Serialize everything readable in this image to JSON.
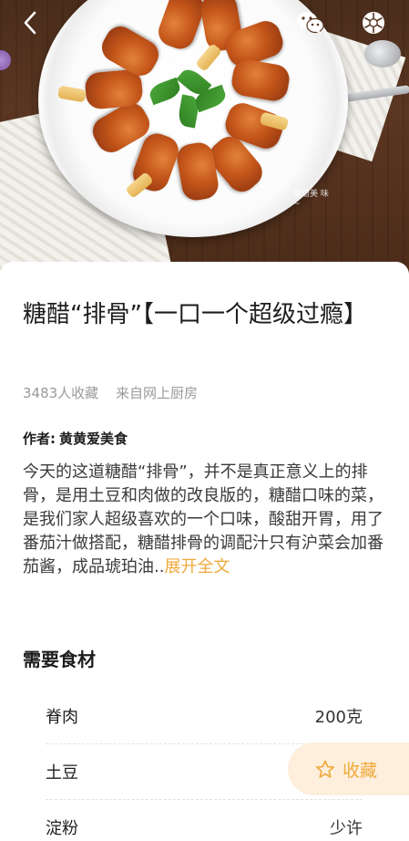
{
  "header": {
    "back_icon": "chevron-left-icon",
    "share_wechat_icon": "wechat-icon",
    "share_moments_icon": "moments-icon",
    "hero_watermark": "糖醋美\n味~"
  },
  "recipe": {
    "title": "糖醋“排骨”【一口一个超级过瘾】",
    "favorites": "3483人收藏",
    "source": "来自网上厨房",
    "author_label": "作者:",
    "author_name": "黄黄爱美食",
    "description": "今天的这道糖醋“排骨”，并不是真正意义上的排骨，是用土豆和肉做的改良版的，糖醋口味的菜，是我们家人超级喜欢的一个口味，酸甜开胃，用了番茄汁做搭配，糖醋排骨的调配汁只有沪菜会加番茄酱，成品琥珀油..",
    "expand_label": "展开全文"
  },
  "ingredients": {
    "section_title": "需要食材",
    "items": [
      {
        "name": "脊肉",
        "qty": "200克"
      },
      {
        "name": "土豆",
        "qty": ""
      },
      {
        "name": "淀粉",
        "qty": "少许"
      }
    ]
  },
  "actions": {
    "collect_label": "收藏",
    "collect_icon": "star-outline-icon"
  },
  "colors": {
    "accent": "#f0a93c",
    "accent_bg": "#fdefdc",
    "muted_text": "#9a9a9a"
  }
}
